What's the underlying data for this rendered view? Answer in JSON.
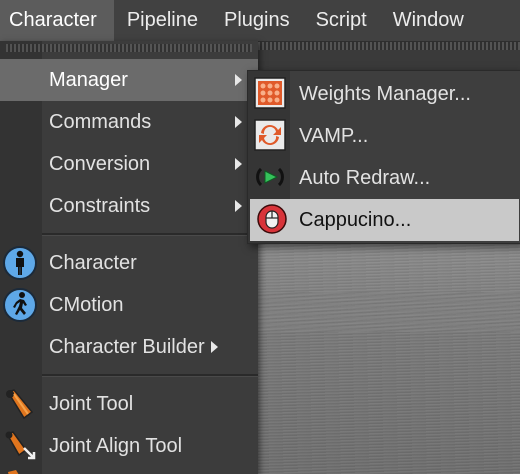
{
  "menubar": {
    "items": [
      "Character",
      "Pipeline",
      "Plugins",
      "Script",
      "Window"
    ],
    "active_index": 0
  },
  "character_menu": {
    "items": [
      {
        "label": "Manager",
        "icon": "none",
        "has_submenu": true,
        "highlighted": true
      },
      {
        "label": "Commands",
        "icon": "none",
        "has_submenu": true
      },
      {
        "label": "Conversion",
        "icon": "none",
        "has_submenu": true
      },
      {
        "label": "Constraints",
        "icon": "none",
        "has_submenu": true
      },
      {
        "label": "Character",
        "icon": "character-figure-icon",
        "has_submenu": false
      },
      {
        "label": "CMotion",
        "icon": "cmotion-walking-figure-icon",
        "has_submenu": false
      },
      {
        "label": "Character Builder",
        "icon": "none",
        "has_submenu": true
      },
      {
        "label": "Joint Tool",
        "icon": "joint-tool-bone-icon",
        "has_submenu": false
      },
      {
        "label": "Joint Align Tool",
        "icon": "joint-align-tool-icon",
        "has_submenu": false
      }
    ]
  },
  "manager_submenu": {
    "items": [
      {
        "label": "Weights Manager...",
        "icon": "weights-manager-grid-icon"
      },
      {
        "label": "VAMP...",
        "icon": "vamp-arrows-icon"
      },
      {
        "label": "Auto Redraw...",
        "icon": "auto-redraw-play-icon"
      },
      {
        "label": "Cappucino...",
        "icon": "cappucino-mouse-icon",
        "highlighted": true
      }
    ]
  },
  "colors": {
    "menubar_bg": "#414141",
    "menu_bg": "#3c3c3c",
    "highlight_menu": "#6b6b6b",
    "highlight_submenu": "#c9c9c9",
    "icon_orange": "#e0751e",
    "icon_blue": "#5ea8e8",
    "icon_red": "#d8343a",
    "icon_green": "#35c15b"
  }
}
